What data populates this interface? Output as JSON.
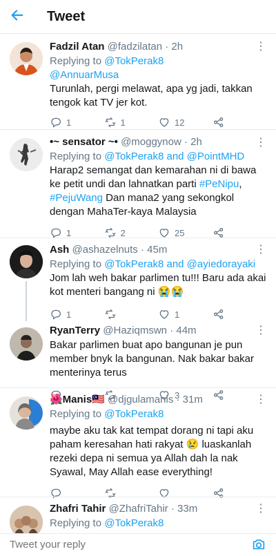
{
  "header": {
    "title": "Tweet"
  },
  "tweets": [
    {
      "name": "Fadzil Atan",
      "handle": "@fadzilatan",
      "time": "· 2h",
      "replying_to": "@TokPerak8",
      "mention_line": "@AnnuarMusa",
      "text": "Turunlah, pergi melawat, apa yg jadi, takkan tengok kat TV jer kot.",
      "replies": "1",
      "retweets": "1",
      "likes": "12"
    },
    {
      "name": "•~ sensator ~•",
      "handle": "@moggynow",
      "time": "· 2h",
      "replying_to": "@TokPerak8 and @PointMHD",
      "text_a": "Harap2 semangat dan kemarahan ni di bawa ke petit undi dan lahnatkan parti ",
      "tag1": "#PeNipu",
      "sep": ", ",
      "tag2": "#PejuWang",
      "text_b": " Dan mana2 yang sekongkol dengan MahaTer-kaya Malaysia",
      "replies": "1",
      "retweets": "2",
      "likes": "25"
    },
    {
      "name": "Ash",
      "handle": "@ashazelnuts",
      "time": "· 45m",
      "replying_to": "@TokPerak8 and @ayiedorayaki",
      "text": "Jom lah weh bakar parlimen tu!!! Baru ada akai kot menteri bangang ni 😭😭",
      "replies": "1",
      "retweets": "",
      "likes": "1"
    },
    {
      "name": "RyanTerry",
      "handle": "@Haziqmswn",
      "time": "· 44m",
      "text": "Bakar parlimen buat apo bangunan je pun member bnyk la bangunan. Nak bakar bakar menterinya terus",
      "replies": "",
      "retweets": "",
      "likes": "3"
    },
    {
      "name": "🌺Manis🇲🇾",
      "handle": "@djgulamanis",
      "time": "· 31m",
      "replying_to": "@TokPerak8",
      "text": "maybe aku tak kat tempat dorang ni tapi aku paham keresahan hati rakyat 😢 luaskanlah rezeki depa ni semua ya Allah dah la nak Syawal, May Allah ease everything!",
      "replies": "",
      "retweets": "",
      "likes": ""
    },
    {
      "name": "Zhafri Tahir",
      "handle": "@ZhafriTahir",
      "time": "· 33m",
      "replying_to": "@TokPerak8"
    }
  ],
  "labels": {
    "replying": "Replying to "
  },
  "reply_bar": {
    "placeholder": "Tweet your reply"
  },
  "colors": {
    "accent": "#1da1f2",
    "muted": "#657786"
  }
}
